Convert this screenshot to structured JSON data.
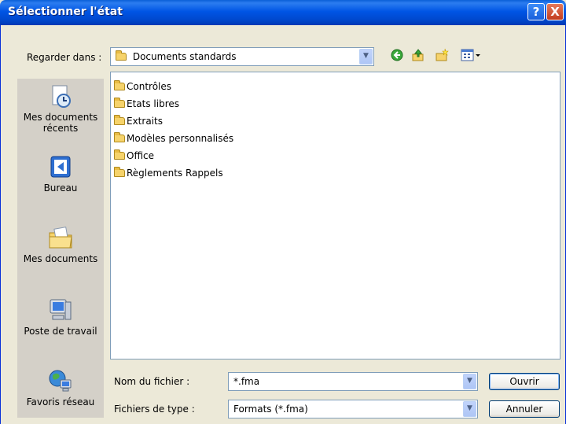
{
  "window": {
    "title": "Sélectionner l'état",
    "help_glyph": "?",
    "close_glyph": "X"
  },
  "lookin": {
    "label": "Regarder dans :",
    "value": "Documents standards"
  },
  "toolbar": {
    "back_icon": "back-icon",
    "up_icon": "up-folder-icon",
    "new_folder_icon": "new-folder-icon",
    "views_icon": "views-menu-icon"
  },
  "places": [
    {
      "label": "Mes documents récents",
      "icon": "recent-documents-icon"
    },
    {
      "label": "Bureau",
      "icon": "desktop-icon"
    },
    {
      "label": "Mes documents",
      "icon": "my-documents-icon"
    },
    {
      "label": "Poste de travail",
      "icon": "my-computer-icon"
    },
    {
      "label": "Favoris réseau",
      "icon": "network-places-icon"
    }
  ],
  "files": [
    {
      "name": "Contrôles"
    },
    {
      "name": "Etats libres"
    },
    {
      "name": "Extraits"
    },
    {
      "name": "Modèles personnalisés"
    },
    {
      "name": "Office"
    },
    {
      "name": "Règlements Rappels"
    }
  ],
  "filename": {
    "label": "Nom du fichier :",
    "value": "*.fma"
  },
  "filetype": {
    "label": "Fichiers de type :",
    "value": "Formats (*.fma)"
  },
  "buttons": {
    "open": "Ouvrir",
    "cancel": "Annuler"
  },
  "colors": {
    "titlebar": "#0055E5",
    "dialog_bg": "#ECE9D8",
    "places_bg": "#D4D0C8",
    "border": "#7F9DB9"
  }
}
